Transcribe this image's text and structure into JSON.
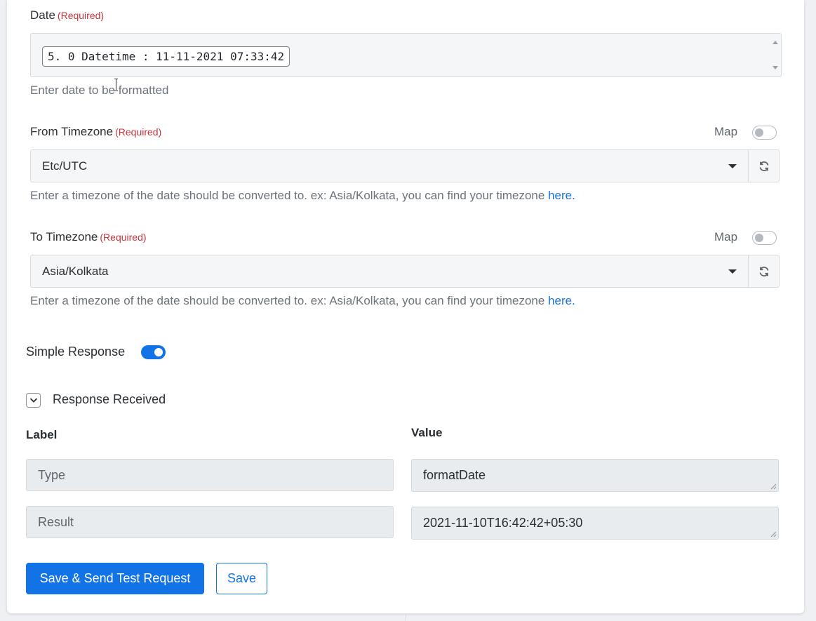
{
  "date_field": {
    "label": "Date",
    "required": "(Required)",
    "chip_value": "5. 0 Datetime : 11-11-2021 07:33:42",
    "help": "Enter date to be formatted"
  },
  "from_timezone": {
    "label": "From Timezone",
    "required": "(Required)",
    "map_label": "Map",
    "value": "Etc/UTC",
    "help_text": "Enter a timezone of the date should be converted to. ex: Asia/Kolkata, you can find your timezone ",
    "help_link": "here."
  },
  "to_timezone": {
    "label": "To Timezone",
    "required": "(Required)",
    "map_label": "Map",
    "value": "Asia/Kolkata",
    "help_text": "Enter a timezone of the date should be converted to. ex: Asia/Kolkata, you can find your timezone ",
    "help_link": "here."
  },
  "simple_response": {
    "label": "Simple Response",
    "enabled": true
  },
  "response": {
    "title": "Response Received",
    "label_header": "Label",
    "value_header": "Value",
    "rows": [
      {
        "label": "Type",
        "value": "formatDate"
      },
      {
        "label": "Result",
        "value": "2021-11-10T16:42:42+05:30"
      }
    ]
  },
  "buttons": {
    "save_send": "Save & Send Test Request",
    "save": "Save"
  },
  "colors": {
    "accent": "#1273e6",
    "required": "#c7343b",
    "link": "#1a73d9"
  }
}
